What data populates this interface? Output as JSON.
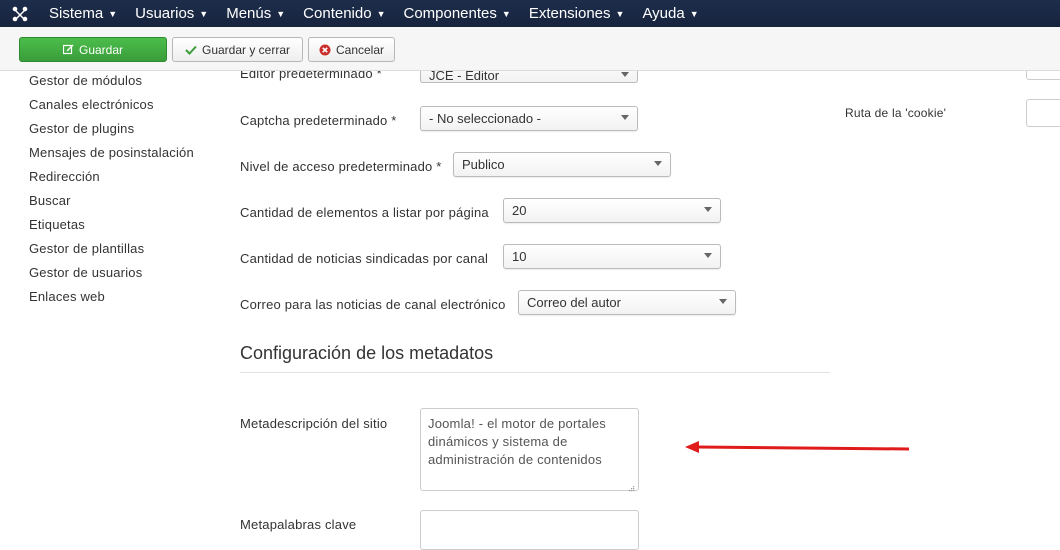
{
  "navbar": {
    "logo": "joomla-logo",
    "menus": [
      "Sistema",
      "Usuarios",
      "Menús",
      "Contenido",
      "Componentes",
      "Extensiones",
      "Ayuda"
    ]
  },
  "toolbar": {
    "save_label": "Guardar",
    "save_close_label": "Guardar y  cerrar",
    "cancel_label": "Cancelar",
    "save_icon": "edit-icon",
    "save_close_icon": "check-icon",
    "cancel_icon": "cancel-circle-icon",
    "save_color": "#46a546"
  },
  "sidebar": {
    "items": [
      "Gestor de módulos",
      "Canales electrónicos",
      "Gestor de plugins",
      "Mensajes de posinstalación",
      "Redirección",
      "Buscar",
      "Etiquetas",
      "Gestor de plantillas",
      "Gestor de usuarios",
      "Enlaces web"
    ]
  },
  "form": {
    "editor": {
      "label": "Editor predeterminado *",
      "value": "JCE - Editor"
    },
    "captcha": {
      "label": "Captcha predeterminado *",
      "value": "- No seleccionado -"
    },
    "access": {
      "label": "Nivel de acceso predeterminado *",
      "value": "Publico"
    },
    "list_limit": {
      "label": "Cantidad de elementos a listar por página",
      "value": "20"
    },
    "feed_limit": {
      "label": "Cantidad de noticias sindicadas por canal",
      "value": "10"
    },
    "feed_email": {
      "label": "Correo para las noticias de canal electrónico",
      "value": "Correo del autor"
    }
  },
  "metadata": {
    "section_title": "Configuración de los metadatos",
    "description": {
      "label": "Metadescripción del sitio",
      "value": "Joomla! - el motor de portales dinámicos y sistema de administración de contenidos"
    },
    "keywords": {
      "label": "Metapalabras clave",
      "value": ""
    }
  },
  "right": {
    "cookie_path_label": "Ruta de la 'cookie'"
  },
  "annotation": {
    "arrow_color": "#e01b1b"
  }
}
